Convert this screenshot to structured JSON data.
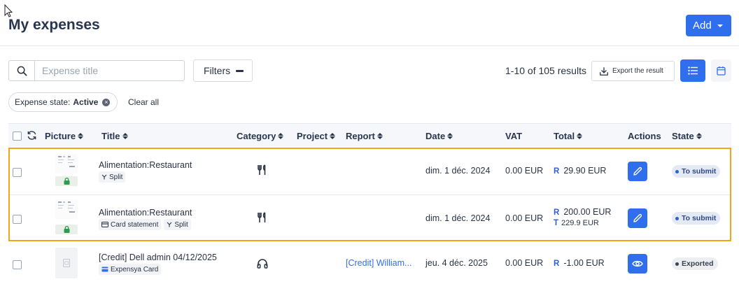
{
  "page": {
    "title": "My expenses",
    "add_label": "Add"
  },
  "toolbar": {
    "search_placeholder": "Expense title",
    "filters_label": "Filters",
    "results_count": "1-10 of 105 results",
    "export_label": "Export the result"
  },
  "active_filter": {
    "key": "Expense state:",
    "value": "Active",
    "clear_all": "Clear all"
  },
  "table": {
    "columns": {
      "picture": "Picture",
      "title": "Title",
      "category": "Category",
      "project": "Project",
      "report": "Report",
      "date": "Date",
      "vat": "VAT",
      "total": "Total",
      "actions": "Actions",
      "state": "State"
    },
    "rows": [
      {
        "title": "Alimentation:Restaurant",
        "tags": [
          "Split"
        ],
        "category_icon": "restaurant-icon",
        "project": "",
        "report": "",
        "date": "dim. 1 déc. 2024",
        "vat": "0.00 EUR",
        "total_r_label": "R",
        "total_r": "29.90 EUR",
        "action_icon": "edit-icon",
        "state": "To submit"
      },
      {
        "title": "Alimentation:Restaurant",
        "tags": [
          "Card statement",
          "Split"
        ],
        "category_icon": "restaurant-icon",
        "project": "",
        "report": "",
        "date": "dim. 1 déc. 2024",
        "vat": "0.00 EUR",
        "total_r_label": "R",
        "total_r": "200.00 EUR",
        "total_t_label": "T",
        "total_t": "229.9 EUR",
        "action_icon": "edit-icon",
        "state": "To submit"
      },
      {
        "title": "[Credit] Dell admin 04/12/2025",
        "tags": [
          "Expensya Card"
        ],
        "category_icon": "headphones-icon",
        "project": "",
        "report": "[Credit] William...",
        "date": "jeu. 4 déc. 2025",
        "vat": "0.00 EUR",
        "total_r_label": "R",
        "total_r": "-1.00 EUR",
        "action_icon": "eye-icon",
        "state": "Exported"
      }
    ]
  },
  "colors": {
    "primary": "#2f6fed",
    "highlight": "#f2a51c",
    "heading": "#27364d"
  }
}
